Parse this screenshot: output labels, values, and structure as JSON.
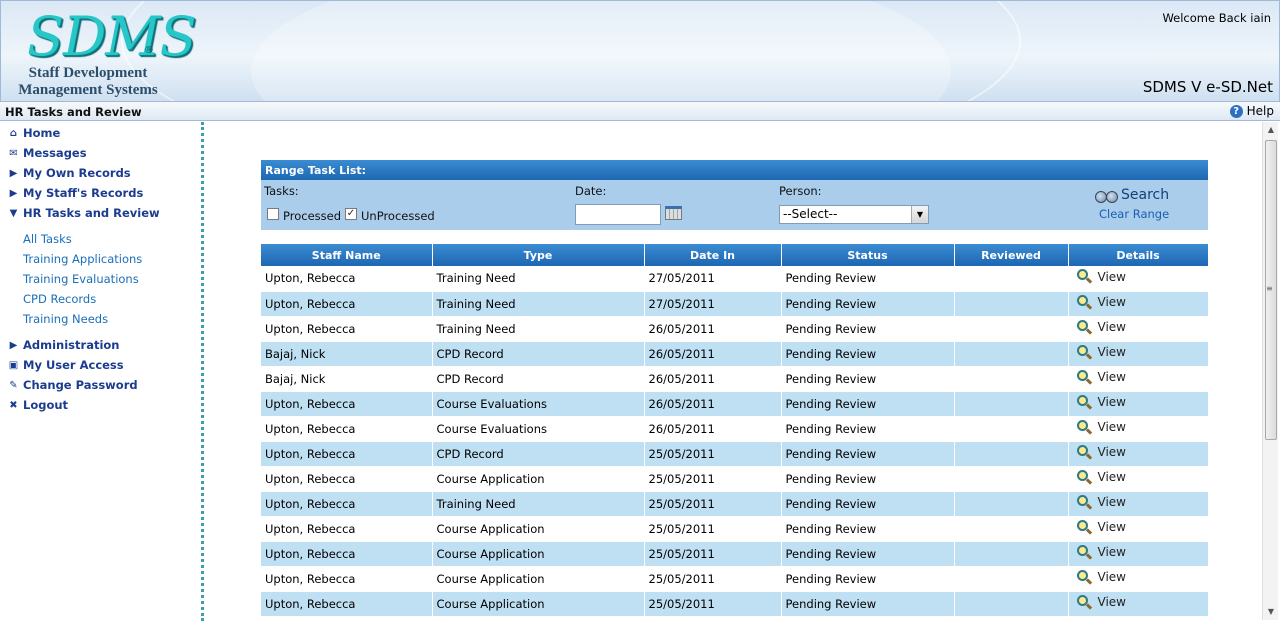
{
  "header": {
    "logo_text": "SDMS",
    "logo_registered": "®",
    "logo_subtitle_line1": "Staff Development",
    "logo_subtitle_line2": "Management Systems",
    "welcome": "Welcome Back iain",
    "version": "SDMS V e-SD.Net"
  },
  "titlebar": {
    "title": "HR Tasks and Review",
    "help_label": "Help",
    "help_icon": "question-icon"
  },
  "sidebar": {
    "items": [
      {
        "label": "Home",
        "icon": "home-icon",
        "glyph": "⌂"
      },
      {
        "label": "Messages",
        "icon": "envelope-icon",
        "glyph": "✉"
      },
      {
        "label": "My Own Records",
        "icon": "triangle-right-icon",
        "glyph": "▶"
      },
      {
        "label": "My Staff's Records",
        "icon": "triangle-right-icon",
        "glyph": "▶"
      },
      {
        "label": "HR Tasks and Review",
        "icon": "triangle-down-icon",
        "glyph": "▼"
      }
    ],
    "subitems": [
      "All Tasks",
      "Training Applications",
      "Training Evaluations",
      "CPD Records",
      "Training Needs"
    ],
    "items_after": [
      {
        "label": "Administration",
        "icon": "triangle-right-icon",
        "glyph": "▶"
      },
      {
        "label": "My User Access",
        "icon": "lock-icon",
        "glyph": "🔒"
      },
      {
        "label": "Change Password",
        "icon": "pen-icon",
        "glyph": "✎"
      },
      {
        "label": "Logout",
        "icon": "close-icon",
        "glyph": "✖"
      }
    ]
  },
  "filter": {
    "heading": "Range Task List:",
    "tasks_label": "Tasks:",
    "processed_label": "Processed",
    "processed_checked": false,
    "unprocessed_label": "UnProcessed",
    "unprocessed_checked": true,
    "date_label": "Date:",
    "date_value": "",
    "person_label": "Person:",
    "person_selected": "--Select--",
    "search_label": "Search",
    "clear_label": "Clear Range"
  },
  "table": {
    "columns": [
      "Staff Name",
      "Type",
      "Date In",
      "Status",
      "Reviewed",
      "Details"
    ],
    "view_label": "View",
    "rows": [
      [
        "Upton, Rebecca",
        "Training Need",
        "27/05/2011",
        "Pending Review",
        ""
      ],
      [
        "Upton, Rebecca",
        "Training Need",
        "27/05/2011",
        "Pending Review",
        ""
      ],
      [
        "Upton, Rebecca",
        "Training Need",
        "26/05/2011",
        "Pending Review",
        ""
      ],
      [
        "Bajaj, Nick",
        "CPD Record",
        "26/05/2011",
        "Pending Review",
        ""
      ],
      [
        "Bajaj, Nick",
        "CPD Record",
        "26/05/2011",
        "Pending Review",
        ""
      ],
      [
        "Upton, Rebecca",
        "Course Evaluations",
        "26/05/2011",
        "Pending Review",
        ""
      ],
      [
        "Upton, Rebecca",
        "Course Evaluations",
        "26/05/2011",
        "Pending Review",
        ""
      ],
      [
        "Upton, Rebecca",
        "CPD Record",
        "25/05/2011",
        "Pending Review",
        ""
      ],
      [
        "Upton, Rebecca",
        "Course Application",
        "25/05/2011",
        "Pending Review",
        ""
      ],
      [
        "Upton, Rebecca",
        "Training Need",
        "25/05/2011",
        "Pending Review",
        ""
      ],
      [
        "Upton, Rebecca",
        "Course Application",
        "25/05/2011",
        "Pending Review",
        ""
      ],
      [
        "Upton, Rebecca",
        "Course Application",
        "25/05/2011",
        "Pending Review",
        ""
      ],
      [
        "Upton, Rebecca",
        "Course Application",
        "25/05/2011",
        "Pending Review",
        ""
      ],
      [
        "Upton, Rebecca",
        "Course Application",
        "25/05/2011",
        "Pending Review",
        ""
      ]
    ]
  },
  "colors": {
    "accent_blue": "#1d67b3",
    "row_alt": "#bfe0f3",
    "panel_bg": "#a9cdea",
    "nav_text": "#1b3c8f",
    "logo_teal": "#27c7c9"
  }
}
